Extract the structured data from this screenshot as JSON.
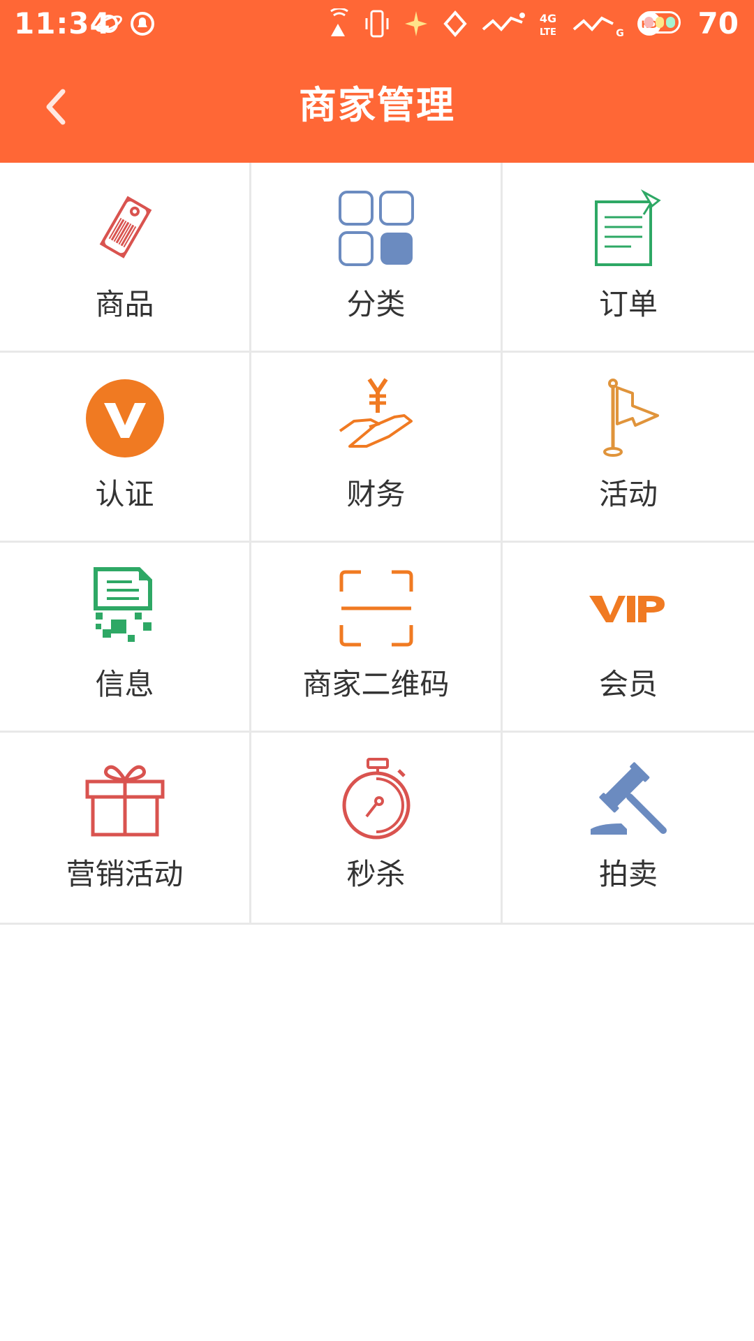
{
  "status_bar": {
    "time": "11:34",
    "battery_level": "70",
    "network_badge": "4G\nLTE"
  },
  "header": {
    "title": "商家管理",
    "back_icon": "chevron-left-icon"
  },
  "colors": {
    "header_bg": "#FF6736",
    "divider": "#e8e8e8",
    "label_text": "#333333",
    "red": "#D9534F",
    "blue": "#6B8BC0",
    "green": "#2EA865",
    "orange": "#F07A22",
    "gold": "#E0943B"
  },
  "menu": {
    "items": [
      {
        "label": "商品",
        "icon": "price-tag-icon"
      },
      {
        "label": "分类",
        "icon": "category-grid-icon"
      },
      {
        "label": "订单",
        "icon": "order-note-icon"
      },
      {
        "label": "认证",
        "icon": "verified-v-icon"
      },
      {
        "label": "财务",
        "icon": "yen-hand-icon"
      },
      {
        "label": "活动",
        "icon": "flag-icon"
      },
      {
        "label": "信息",
        "icon": "info-document-icon"
      },
      {
        "label": "商家二维码",
        "icon": "qr-scan-icon"
      },
      {
        "label": "会员",
        "icon": "vip-icon"
      },
      {
        "label": "营销活动",
        "icon": "gift-box-icon"
      },
      {
        "label": "秒杀",
        "icon": "stopwatch-icon"
      },
      {
        "label": "拍卖",
        "icon": "auction-gavel-icon"
      }
    ]
  }
}
